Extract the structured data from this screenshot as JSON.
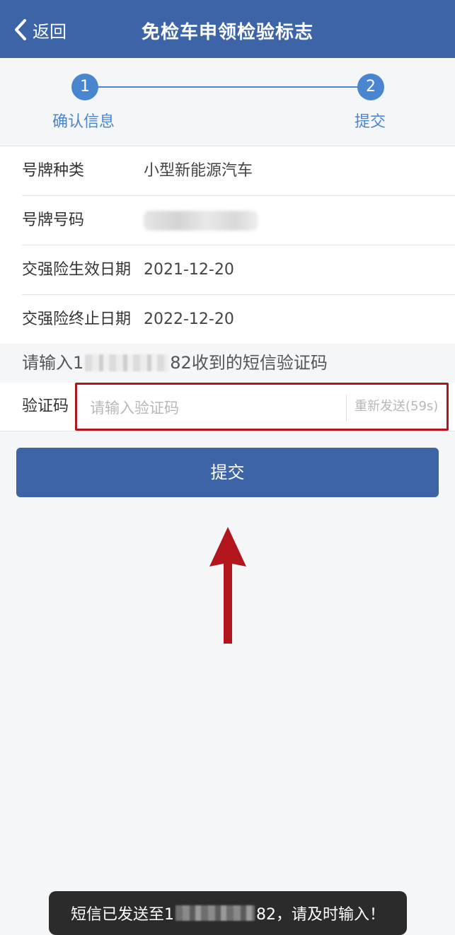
{
  "nav": {
    "back_label": "返回",
    "title": "免检车申领检验标志"
  },
  "steps": [
    {
      "number": "1",
      "label": "确认信息"
    },
    {
      "number": "2",
      "label": "提交"
    }
  ],
  "info_rows": {
    "plate_type": {
      "label": "号牌种类",
      "value": "小型新能源汽车"
    },
    "plate_number": {
      "label": "号牌号码"
    },
    "insurance_start": {
      "label": "交强险生效日期",
      "value": "2021-12-20"
    },
    "insurance_end": {
      "label": "交强险终止日期",
      "value": "2022-12-20"
    }
  },
  "sms_hint": {
    "prefix": "请输入1",
    "suffix": "82收到的短信验证码"
  },
  "verify": {
    "label": "验证码",
    "placeholder": "请输入验证码",
    "resend": "重新发送(59s)"
  },
  "submit_label": "提交",
  "toast": {
    "prefix": "短信已发送至1",
    "suffix": "82，请及时输入！"
  },
  "colors": {
    "primary": "#3d64a6",
    "step": "#4a86cf",
    "highlight": "#b3151d"
  }
}
